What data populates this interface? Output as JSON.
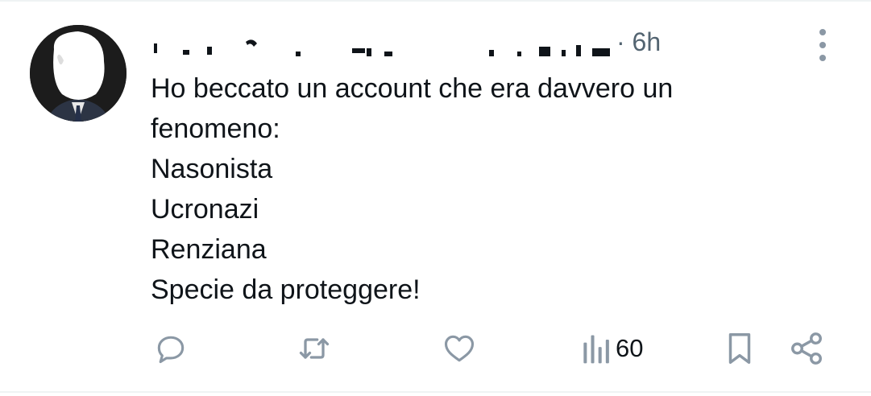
{
  "tweet": {
    "author_redacted": true,
    "time": "· 6h",
    "lines": [
      "Ho beccato un account che era davvero un",
      "fenomeno:",
      "Nasonista",
      "Ucronazi",
      "Renziana",
      "Specie da proteggere!"
    ],
    "views_count": "60"
  },
  "icons": {
    "reply": "reply-icon",
    "retweet": "retweet-icon",
    "like": "like-icon",
    "views": "views-icon",
    "bookmark": "bookmark-icon",
    "share": "share-icon",
    "more": "more-icon"
  },
  "colors": {
    "icon": "#8b98a5",
    "text": "#0f1419",
    "secondary": "#536471"
  }
}
